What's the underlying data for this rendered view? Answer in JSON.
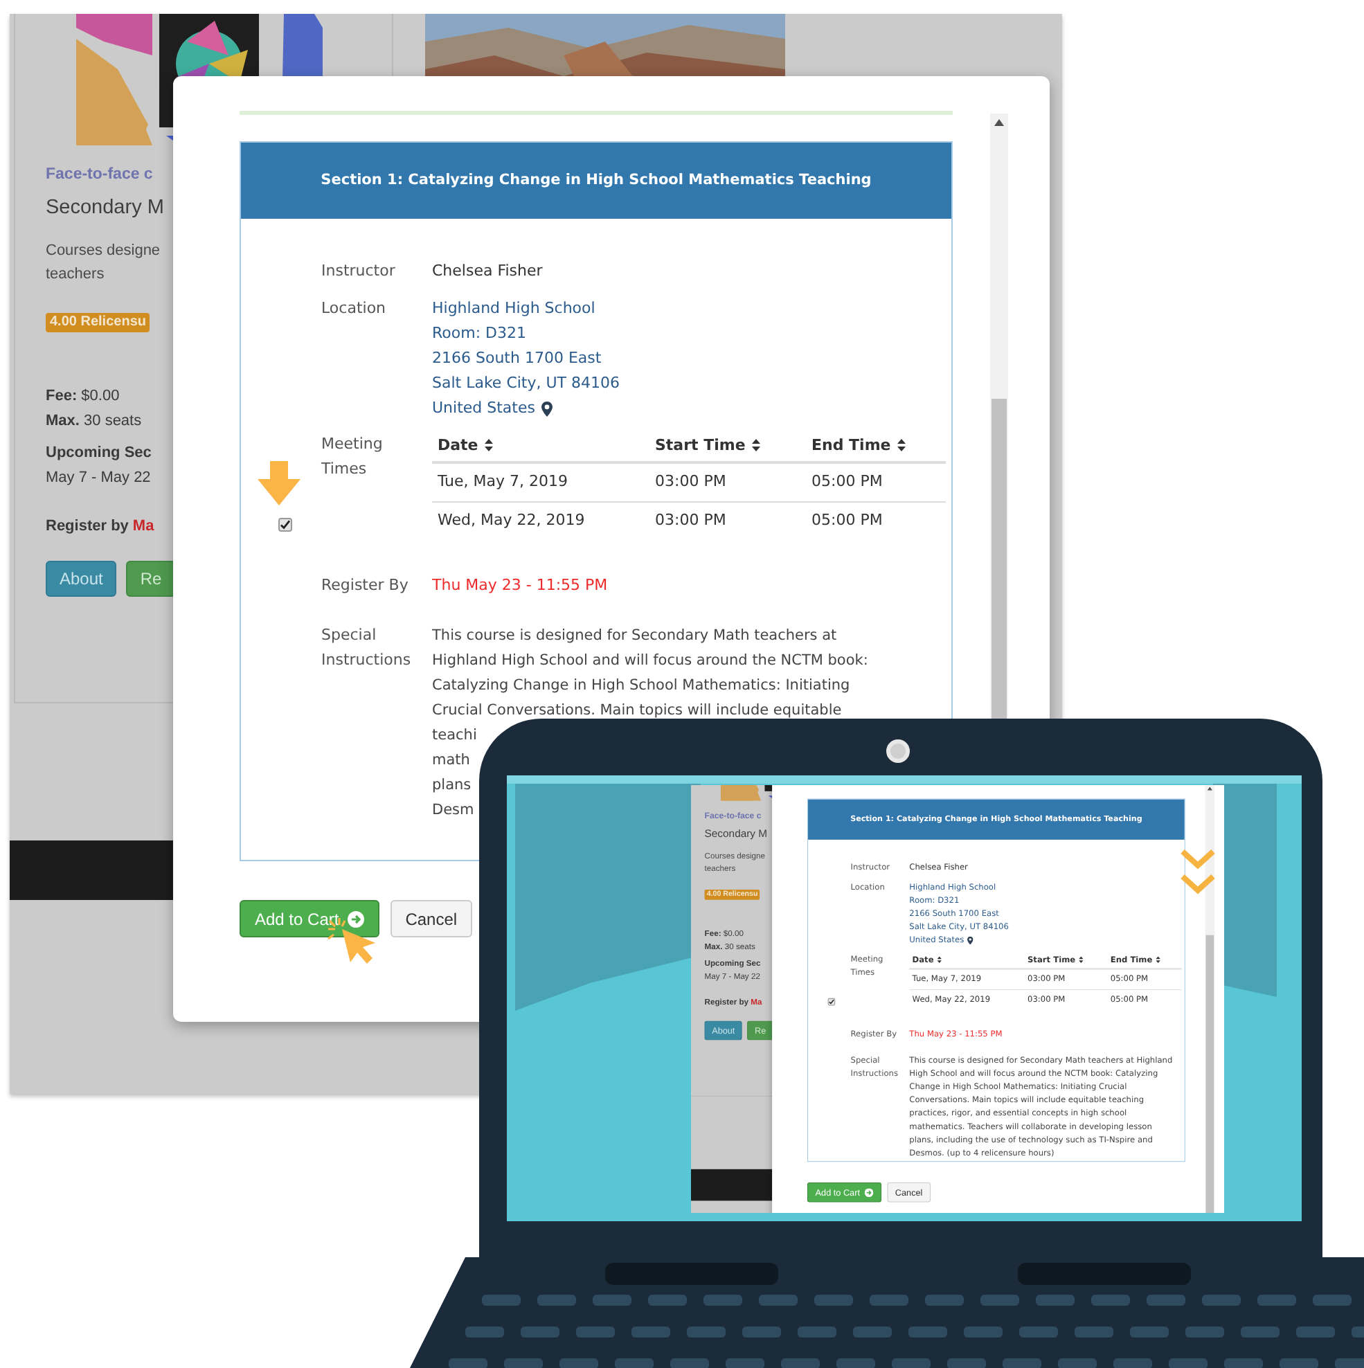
{
  "page": {
    "left_card": {
      "category": "Face-to-face c",
      "title": "Secondary M",
      "description_lines": [
        "Courses designe",
        "teachers"
      ],
      "badge": "4.00 Relicensu",
      "fee": "**Fee:** $0.00",
      "max_seats": "**Max.** 30 seats",
      "upcoming_label": "Upcoming Sec",
      "upcoming_dates": "May 7 - May 22",
      "register_by": {
        "label": "Register by",
        "date": "Ma"
      },
      "buttons": [
        {
          "label": "About",
          "kind": "info"
        },
        {
          "label": "Re",
          "kind": "success"
        }
      ]
    },
    "modal": {
      "section_title": "Section 1: Catalyzing Change in High School Mathematics Teaching",
      "instructor": {
        "label": "Instructor",
        "value": "Chelsea Fisher"
      },
      "location": {
        "label": "Location",
        "lines": [
          "Highland High School",
          "Room: D321",
          "2166 South 1700 East",
          "Salt Lake City, UT 84106",
          "United States"
        ]
      },
      "meeting_times": {
        "label": "Meeting Times",
        "checked": true,
        "columns": [
          "Date",
          "Start Time",
          "End Time"
        ],
        "rows": [
          [
            "Tue, May 7, 2019",
            "03:00 PM",
            "05:00 PM"
          ],
          [
            "Wed, May 22, 2019",
            "03:00 PM",
            "05:00 PM"
          ]
        ]
      },
      "register_by": {
        "label": "Register By",
        "value": "Thu May 23 - 11:55 PM"
      },
      "special_instructions": {
        "label": "Special Instructions",
        "text": [
          "This course is designed for Secondary Math teachers at",
          "Highland High School and will focus around the NCTM book:",
          "Catalyzing Change in High School Mathematics: Initiating",
          "Crucial Conversations. Main topics will include equitable",
          "teachi",
          "math",
          "plans",
          "Desm"
        ]
      },
      "buttons": [
        {
          "label": "Add to Cart",
          "kind": "primary"
        },
        {
          "label": "Cancel",
          "kind": "default"
        }
      ]
    }
  },
  "laptop_screen": {
    "left_card": {
      "category": "Face-to-face c",
      "title": "Secondary M",
      "description_lines": [
        "Courses designe",
        "teachers"
      ],
      "badge": "4.00 Relicensu",
      "fee": "**Fee:** $0.00",
      "max_seats": "**Max.** 30 seats",
      "upcoming_label": "Upcoming Sec",
      "upcoming_dates": "May 7 - May 22",
      "register_by": {
        "label": "Register by",
        "date": "Ma"
      },
      "buttons": [
        {
          "label": "About",
          "kind": "info"
        },
        {
          "label": "Re",
          "kind": "success"
        }
      ]
    },
    "modal": {
      "section_title": "Section 1: Catalyzing Change in High School Mathematics Teaching",
      "instructor": {
        "label": "Instructor",
        "value": "Chelsea Fisher"
      },
      "location": {
        "label": "Location",
        "lines": [
          "Highland High School",
          "Room: D321",
          "2166 South 1700 East",
          "Salt Lake City, UT 84106",
          "United States"
        ]
      },
      "meeting_times": {
        "label": "Meeting Times",
        "checked": true,
        "columns": [
          "Date",
          "Start Time",
          "End Time"
        ],
        "rows": [
          [
            "Tue, May 7, 2019",
            "03:00 PM",
            "05:00 PM"
          ],
          [
            "Wed, May 22, 2019",
            "03:00 PM",
            "05:00 PM"
          ]
        ]
      },
      "register_by": {
        "label": "Register By",
        "value": "Thu May 23 - 11:55 PM"
      },
      "special_instructions": {
        "label": "Special Instructions",
        "text": "This course is designed for Secondary Math teachers at Highland High School and will focus around the NCTM book: Catalyzing Change in High School Mathematics: Initiating Crucial Conversations. Main topics will include equitable teaching practices, rigor, and essential concepts in high school mathematics. Teachers will collaborate in developing lesson plans, including the use of technology such as TI-Nspire and Desmos. (up to 4 relicensure hours)"
      },
      "buttons": [
        {
          "label": "Add to Cart",
          "kind": "primary"
        },
        {
          "label": "Cancel",
          "kind": "default"
        }
      ]
    }
  }
}
